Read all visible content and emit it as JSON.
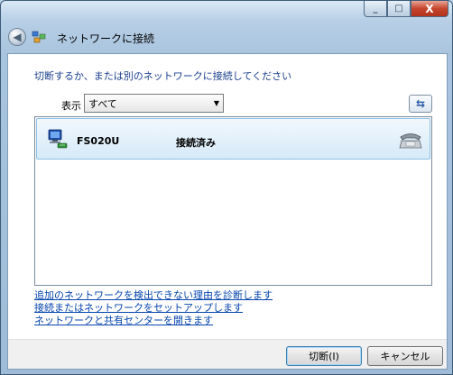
{
  "window": {
    "title": "ネットワークに接続",
    "caption": {
      "minimize": "_",
      "maximize": "□",
      "close": "X"
    }
  },
  "instruction": "切断するか、または別のネットワークに接続してください",
  "filter": {
    "label": "表示",
    "selected": "すべて"
  },
  "networks": [
    {
      "name": "FS020U",
      "status": "接続済み",
      "icon": "wired-network-icon",
      "type_icon": "phone-dialup-icon"
    }
  ],
  "links": {
    "diagnose": "追加のネットワークを検出できない理由を診断します",
    "setup": "接続またはネットワークをセットアップします",
    "sharing_center": "ネットワークと共有センターを開きます"
  },
  "buttons": {
    "connect": "切断(I)",
    "cancel": "キャンセル"
  },
  "colors": {
    "link": "#0645ad",
    "instruction": "#1a3e8c",
    "selected_row": "#d6eaf8"
  }
}
